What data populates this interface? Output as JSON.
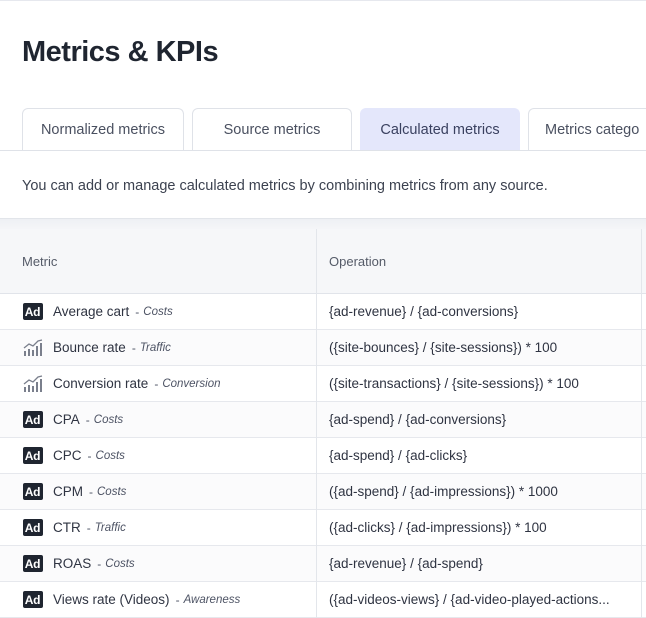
{
  "page": {
    "title": "Metrics & KPIs"
  },
  "tabs": [
    {
      "label": "Normalized metrics",
      "active": false
    },
    {
      "label": "Source metrics",
      "active": false
    },
    {
      "label": "Calculated metrics",
      "active": true
    },
    {
      "label": "Metrics catego",
      "active": false
    }
  ],
  "description": "You can add or manage calculated metrics by combining metrics from any source.",
  "table": {
    "columns": {
      "metric": "Metric",
      "operation": "Operation"
    },
    "rows": [
      {
        "icon": "ad-icon",
        "name": "Average cart",
        "category": "Costs",
        "operation": "{ad-revenue} / {ad-conversions}"
      },
      {
        "icon": "site-analytics-icon",
        "name": "Bounce rate",
        "category": "Traffic",
        "operation": "({site-bounces} / {site-sessions}) * 100"
      },
      {
        "icon": "site-analytics-icon",
        "name": "Conversion rate",
        "category": "Conversion",
        "operation": "({site-transactions} / {site-sessions}) * 100"
      },
      {
        "icon": "ad-icon",
        "name": "CPA",
        "category": "Costs",
        "operation": "{ad-spend} / {ad-conversions}"
      },
      {
        "icon": "ad-icon",
        "name": "CPC",
        "category": "Costs",
        "operation": "{ad-spend} / {ad-clicks}"
      },
      {
        "icon": "ad-icon",
        "name": "CPM",
        "category": "Costs",
        "operation": "({ad-spend} / {ad-impressions}) * 1000"
      },
      {
        "icon": "ad-icon",
        "name": "CTR",
        "category": "Traffic",
        "operation": "({ad-clicks} / {ad-impressions}) * 100"
      },
      {
        "icon": "ad-icon",
        "name": "ROAS",
        "category": "Costs",
        "operation": "{ad-revenue} / {ad-spend}"
      },
      {
        "icon": "ad-icon",
        "name": "Views rate (Videos)",
        "category": "Awareness",
        "operation": "({ad-videos-views} / {ad-video-played-actions..."
      }
    ]
  },
  "icons": {
    "ad_label": "Ad"
  }
}
